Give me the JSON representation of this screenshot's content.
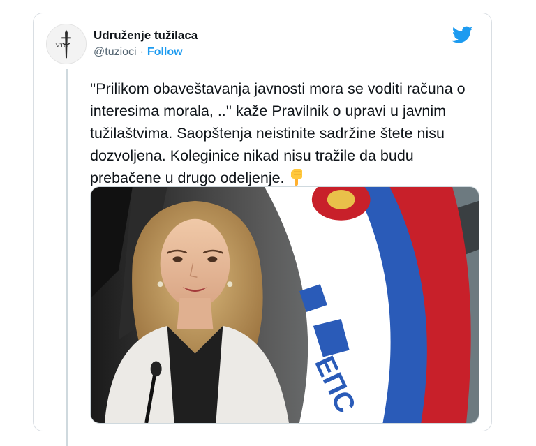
{
  "account": {
    "display_name": "Udruženje tužilaca",
    "handle": "@tuzioci",
    "separator": "·",
    "follow_label": "Follow",
    "avatar_text": "VTG"
  },
  "tweet": {
    "text": "''Prilikom obaveštavanja javnosti mora se voditi računa o interesima morala, ..'' kaže Pravilnik o upravi u javnim tužilaštvima. Saopštenja neistinite sadržine štete nisu dozvoljena. Koleginice nikad nisu tražile da budu prebačene u drugo odeljenje.",
    "emoji_name": "backhand-index-pointing-down"
  },
  "media": {
    "banner_text": "ЕПС",
    "description_icon": "photo"
  },
  "colors": {
    "accent": "#1d9bf0",
    "text": "#0f1419",
    "muted": "#536471",
    "border": "#cfd9de"
  },
  "icons": {
    "brand": "twitter-bird-icon"
  }
}
